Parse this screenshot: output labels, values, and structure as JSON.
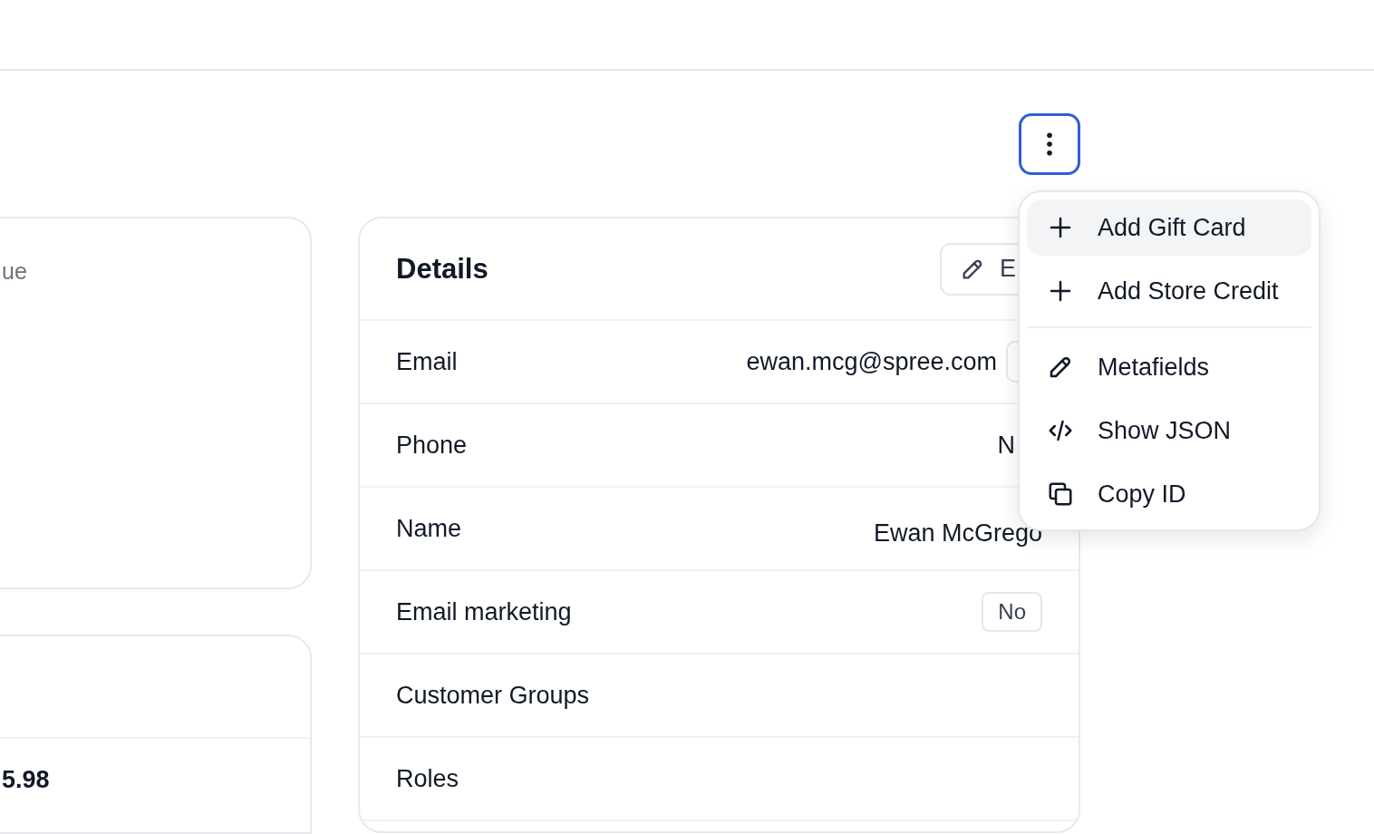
{
  "left_cards": [
    {
      "label": "ue"
    },
    {
      "value": "5.98"
    }
  ],
  "actions_button": {
    "focused": true
  },
  "details": {
    "title": "Details",
    "edit_button": "E",
    "rows": [
      {
        "kind": "copy",
        "label": "Email",
        "value": "ewan.mcg@spree.com"
      },
      {
        "kind": "phone",
        "label": "Phone",
        "value": "N"
      },
      {
        "kind": "name",
        "label": "Name",
        "value": "Ewan McGrego"
      },
      {
        "kind": "badge",
        "label": "Email marketing",
        "value": "No"
      },
      {
        "kind": "text",
        "label": "Customer Groups"
      },
      {
        "kind": "text",
        "label": "Roles"
      }
    ]
  },
  "menu": [
    {
      "kind": "plus",
      "label": "Add Gift Card",
      "selected": true
    },
    {
      "kind": "plus",
      "label": "Add Store Credit",
      "selected": false
    },
    {
      "kind": "divider"
    },
    {
      "kind": "pencil",
      "label": "Metafields",
      "selected": false
    },
    {
      "kind": "code",
      "label": "Show JSON",
      "selected": false
    },
    {
      "kind": "copy",
      "label": "Copy ID",
      "selected": false
    }
  ]
}
